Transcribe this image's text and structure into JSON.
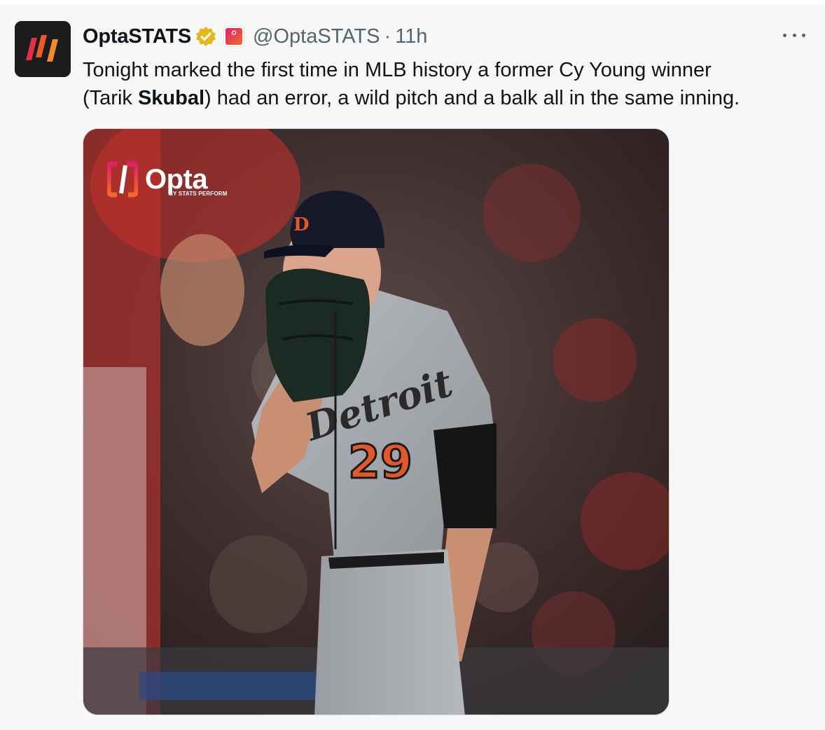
{
  "tweet": {
    "display_name": "OptaSTATS",
    "handle": "@OptaSTATS",
    "separator": "·",
    "time": "11h",
    "text_line1": "Tonight marked the first time in MLB history a former Cy Young winner",
    "text_line2_pre": "(Tarik ",
    "text_line2_bold": "Skubal",
    "text_line2_post": ") had an error, a wild pitch and a balk all in the same inning.",
    "affiliate_badge_text": "O",
    "more_icon": "more-horizontal-icon",
    "verified_icon": "verified-badge-icon"
  },
  "media": {
    "overlay_logo_word": "Opta",
    "overlay_logo_sub": "BY STATS PERFORM",
    "jersey_text": "Detroit",
    "jersey_number": "29"
  },
  "colors": {
    "background": "#f7f7f7",
    "text_primary": "#0f1419",
    "text_secondary": "#536471",
    "verified_gold": "#e2b719",
    "opta_pink": "#e0206a",
    "opta_orange": "#f06a28"
  }
}
